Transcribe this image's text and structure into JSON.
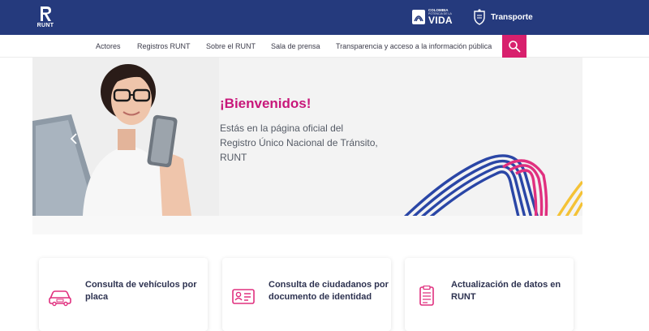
{
  "header": {
    "logo_text": "RUNT",
    "colombia_small": "COLOMBIA",
    "colombia_tagline": "POTENCIA DE LA",
    "colombia_big": "VIDA",
    "transporte": "Transporte"
  },
  "nav": {
    "items": [
      {
        "label": "Actores"
      },
      {
        "label": "Registros RUNT"
      },
      {
        "label": "Sobre el RUNT"
      },
      {
        "label": "Sala de prensa"
      },
      {
        "label": "Transparencia y acceso a la información pública"
      }
    ]
  },
  "hero": {
    "title": "¡Bienvenidos!",
    "description": "Estás en la página oficial del Registro Único Nacional de Tránsito, RUNT"
  },
  "cards": [
    {
      "label": "Consulta de vehículos por placa",
      "icon": "car-icon"
    },
    {
      "label": "Consulta de ciudadanos por documento de identidad",
      "icon": "id-card-icon"
    },
    {
      "label": "Actualización de datos en RUNT",
      "icon": "document-icon"
    }
  ],
  "colors": {
    "header_bg": "#253A7D",
    "accent": "#D8206D",
    "title": "#C8177A"
  }
}
